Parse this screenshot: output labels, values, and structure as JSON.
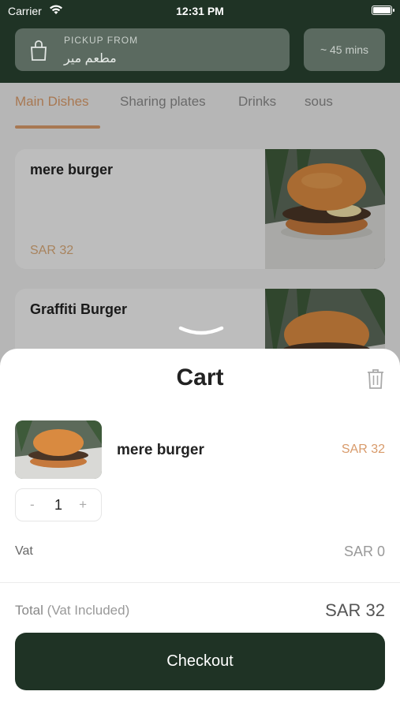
{
  "status_bar": {
    "carrier": "Carrier",
    "time": "12:31 PM"
  },
  "header": {
    "pickup_label": "PICKUP FROM",
    "pickup_value": "مطعم مير",
    "eta": "~ 45 mins"
  },
  "tabs": [
    {
      "label": "Main Dishes",
      "active": true
    },
    {
      "label": "Sharing plates"
    },
    {
      "label": "Drinks"
    },
    {
      "label": "sous"
    }
  ],
  "menu": {
    "items": [
      {
        "name": "mere burger",
        "price": "SAR 32"
      },
      {
        "name": "Graffiti Burger"
      }
    ]
  },
  "cart": {
    "title": "Cart",
    "item": {
      "name": "mere burger",
      "price": "SAR 32",
      "quantity": "1",
      "minus": "-",
      "plus": "+"
    },
    "vat_label": "Vat",
    "vat_value": "SAR 0",
    "total_label": "Total",
    "total_note": "(Vat Included)",
    "total_value": "SAR 32",
    "checkout_label": "Checkout"
  },
  "colors": {
    "brand_green": "#1f3325",
    "accent": "#d89a6a"
  }
}
